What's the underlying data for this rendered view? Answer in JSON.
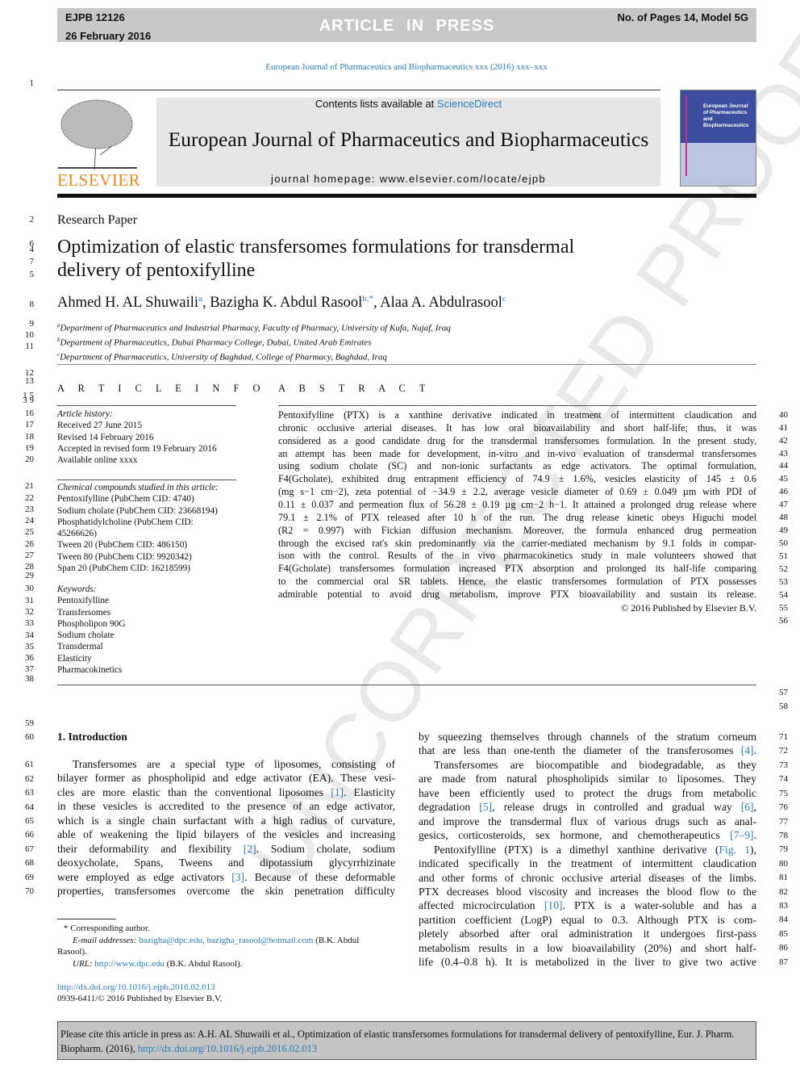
{
  "banner": {
    "code": "EJPB 12126",
    "date": "26 February 2016",
    "status": "ARTICLE  IN  PRESS",
    "pages": "No. of Pages 14, Model 5G"
  },
  "journal_ref": "European Journal of Pharmaceutics and Biopharmaceutics xxx (2016) xxx–xxx",
  "masthead": {
    "contents_prefix": "Contents lists available at ",
    "contents_link": "ScienceDirect",
    "journal_title": "European Journal of Pharmaceutics and Biopharmaceutics",
    "homepage": "journal homepage: www.elsevier.com/locate/ejpb",
    "publisher_logo": "ELSEVIER",
    "cover_title": "European Journal of Pharmaceutics and Biopharmaceutics"
  },
  "watermark": "UNCORRECTED PROOF",
  "article_type": "Research Paper",
  "title_lines": [
    "Optimization of elastic transfersomes formulations for transdermal",
    "delivery of pentoxifylline"
  ],
  "authors": [
    {
      "name": "Ahmed H. AL Shuwaili",
      "sup": "a"
    },
    {
      "name": "Bazigha K. Abdul Rasool",
      "sup": "b,*"
    },
    {
      "name": "Alaa A. Abdulrasool",
      "sup": "c"
    }
  ],
  "affiliations": [
    {
      "sup": "a",
      "text": "Department of Pharmaceutics and Industrial Pharmacy, Faculty of Pharmacy, University of Kufa, Najaf, Iraq"
    },
    {
      "sup": "b",
      "text": "Department of Pharmaceutics, Dubai Pharmacy College, Dubai, United Arab Emirates"
    },
    {
      "sup": "c",
      "text": "Department of Pharmaceutics, University of Baghdad, College of Pharmacy, Baghdad, Iraq"
    }
  ],
  "article_info": {
    "heading": "A R T I C L E   I N F O",
    "history_label": "Article history:",
    "history": [
      "Received 27 June 2015",
      "Revised 14 February 2016",
      "Accepted in revised form 19 February 2016",
      "Available online xxxx"
    ],
    "compounds_label": "Chemical compounds studied in this article:",
    "compounds": [
      "Pentoxifylline (PubChem CID: 4740)",
      "Sodium cholate (PubChem CID: 23668194)",
      "Phosphatidylcholine (PubChem CID:",
      "45266626)",
      "Tween 20 (PubChem CID: 486150)",
      "Tween 80 (PubChem CID: 9920342)",
      "Span 20 (PubChem CID: 16218599)"
    ],
    "keywords_label": "Keywords:",
    "keywords": [
      "Pentoxifylline",
      "Transfersomes",
      "Phospholipon 90G",
      "Sodium cholate",
      "Transdermal",
      "Elasticity",
      "Pharmacokinetics"
    ]
  },
  "abstract": {
    "heading": "A B S T R A C T",
    "lines": [
      "Pentoxifylline (PTX) is a xanthine derivative indicated in treatment of intermittent claudication and",
      "chronic occlusive arterial diseases. It has low oral bioavailability and short half-life; thus, it was",
      "considered as a good candidate drug for the transdermal transfersomes formulation. In the present study,",
      "an attempt has been made for development, in-vitro and in-vivo evaluation of transdermal transfersomes",
      "using sodium cholate (SC) and non-ionic surfactants as edge activators. The optimal formulation,",
      "F4(Gcholate), exhibited drug entrapment efficiency of 74.9 ± 1.6%, vesicles elasticity of 145 ± 0.6",
      "(mg s−1 cm−2), zeta potential of −34.9 ± 2.2, average vesicle diameter of 0.69 ± 0.049 µm with PDI of",
      "0.11 ± 0.037 and permeation flux of 56.28 ± 0.19 µg cm−2 h−1. It attained a prolonged drug release where",
      "79.1 ± 2.1% of PTX released after 10 h of the run. The drug release kinetic obeys Higuchi model",
      "(R2 = 0.997) with Fickian diffusion mechanism. Moreover, the formula enhanced drug permeation",
      "through the excised rat's skin predominantly via the carrier-mediated mechanism by 9.1 folds in compar-",
      "ison with the control. Results of the in vivo pharmacokinetics study in male volunteers showed that",
      "F4(Gcholate) transfersomes formulation increased PTX absorption and prolonged its half-life comparing",
      "to the commercial oral SR tablets. Hence, the elastic transfersomes formulation of PTX possesses",
      "admirable potential to avoid drug metabolism, improve PTX bioavailability and sustain its release."
    ],
    "copyright": "© 2016 Published by Elsevier B.V."
  },
  "intro": {
    "heading": "1. Introduction",
    "left_lines": [
      "Transfersomes are a special type of liposomes, consisting of",
      "bilayer former as phospholipid and edge activator (EA). These vesi-",
      "cles are more elastic than the conventional liposomes [1]. Elasticity",
      "in these vesicles is accredited to the presence of an edge activator,",
      "which is a single chain surfactant with a high radius of curvature,",
      "able of weakening the lipid bilayers of the vesicles and increasing",
      "their deformability and flexibility [2]. Sodium cholate, sodium",
      "deoxycholate, Spans, Tweens and dipotassium glycyrrhizinate",
      "were employed as edge activators [3]. Because of these deformable",
      "properties, transfersomes overcome the skin penetration difficulty"
    ],
    "right_lines": [
      "by squeezing themselves through channels of the stratum corneum",
      "that are less than one-tenth the diameter of the transferosomes [4].",
      "Transfersomes are biocompatible and biodegradable, as they",
      "are made from natural phospholipids similar to liposomes. They",
      "have been efficiently used to protect the drugs from metabolic",
      "degradation [5], release drugs in controlled and gradual way [6],",
      "and improve the transdermal flux of various drugs such as anal-",
      "gesics, corticosteroids, sex hormone, and chemotherapeutics [7–9].",
      "Pentoxifylline (PTX) is a dimethyl xanthine derivative (Fig. 1),",
      "indicated specifically in the treatment of intermittent claudication",
      "and other forms of chronic occlusive arterial diseases of the limbs.",
      "PTX decreases blood viscosity and increases the blood flow to the",
      "affected microcirculation [10]. PTX is a water-soluble and has a",
      "partition coefficient (LogP) equal to 0.3. Although PTX is com-",
      "pletely absorbed after oral administration it undergoes first-pass",
      "metabolism results in a low bioavailability (20%) and short half-",
      "life (0.4–0.8 h). It is metabolized in the liver to give two active"
    ]
  },
  "footnotes": {
    "corresponding": "* Corresponding author.",
    "email_label": "E-mail addresses:",
    "email1": "bazigha@dpc.edu",
    "email2": "bazigha_rasool@hotmail.com",
    "email_owner": "(B.K. Abdul",
    "email_owner2": "Rasool).",
    "url_label": "URL:",
    "url": "http://www.dpc.edu",
    "url_owner": "(B.K. Abdul Rasool).",
    "doi": "http://dx.doi.org/10.1016/j.ejpb.2016.02.013",
    "issn": "0939-6411/© 2016 Published by Elsevier B.V."
  },
  "citation": {
    "text": "Please cite this article in press as: A.H. AL Shuwaili et al., Optimization of elastic transfersomes formulations for transdermal delivery of pentoxifylline, Eur. J. Pharm. Biopharm. (2016), ",
    "link": "http://dx.doi.org/10.1016/j.ejpb.2016.02.013"
  },
  "line_numbers": {
    "left": [
      "1",
      "2",
      "6",
      "4",
      "7",
      "5",
      "8",
      "9",
      "10",
      "11",
      "12",
      "13",
      "1 5",
      "3 9",
      "16",
      "17",
      "18",
      "19",
      "20",
      "21",
      "22",
      "23",
      "24",
      "25",
      "26",
      "27",
      "28",
      "29",
      "30",
      "31",
      "32",
      "33",
      "34",
      "35",
      "36",
      "37",
      "38",
      "59",
      "60",
      "61",
      "62",
      "63",
      "64",
      "65",
      "66",
      "67",
      "68",
      "69",
      "70"
    ],
    "right": [
      "40",
      "41",
      "42",
      "43",
      "44",
      "45",
      "46",
      "47",
      "48",
      "49",
      "50",
      "51",
      "52",
      "53",
      "54",
      "55",
      "56",
      "57",
      "58",
      "71",
      "72",
      "73",
      "74",
      "75",
      "76",
      "77",
      "78",
      "79",
      "80",
      "81",
      "82",
      "83",
      "84",
      "85",
      "86",
      "87"
    ]
  },
  "colors": {
    "link": "#2a7db8",
    "banner": "#c8c8c8",
    "elsevier_orange": "#f08a1c"
  }
}
